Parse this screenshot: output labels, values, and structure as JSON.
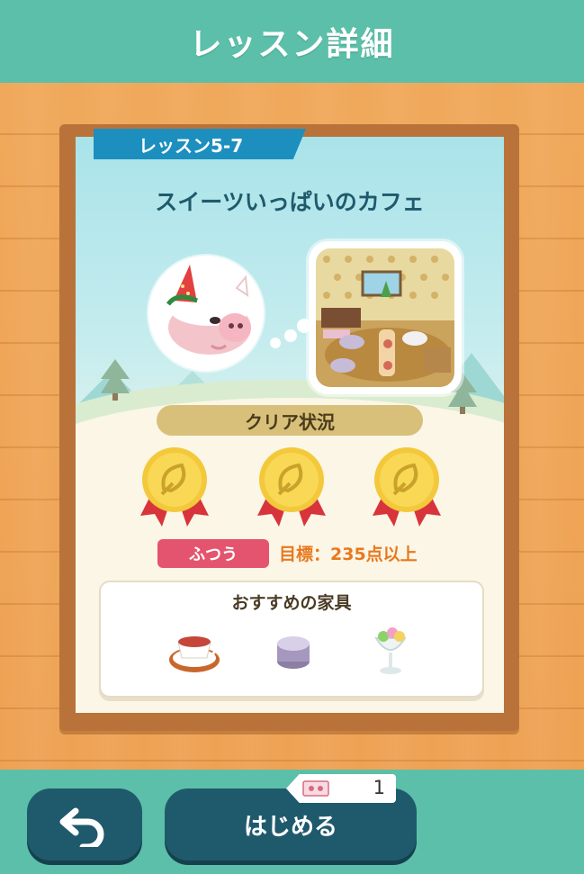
{
  "header": {
    "title": "レッスン詳細"
  },
  "lesson": {
    "tag": "レッスン5-7",
    "title": "スイーツいっぱいのカフェ"
  },
  "clear_status": {
    "label": "クリア状況",
    "medals": [
      "leaf-medal",
      "leaf-medal",
      "leaf-medal"
    ]
  },
  "difficulty": {
    "label": "ふつう",
    "goal": "目標：235点以上"
  },
  "recommended": {
    "title": "おすすめの家具",
    "items": [
      "teacup-icon",
      "cushion-icon",
      "parfait-icon"
    ]
  },
  "footer": {
    "start_label": "はじめる",
    "ticket_count": "1"
  },
  "colors": {
    "header": "#5cbfa9",
    "button": "#1f5a6c",
    "tag": "#1c8fbf",
    "difficulty": "#e5546e",
    "goal": "#e8781e",
    "medal": "#f3c93b"
  }
}
